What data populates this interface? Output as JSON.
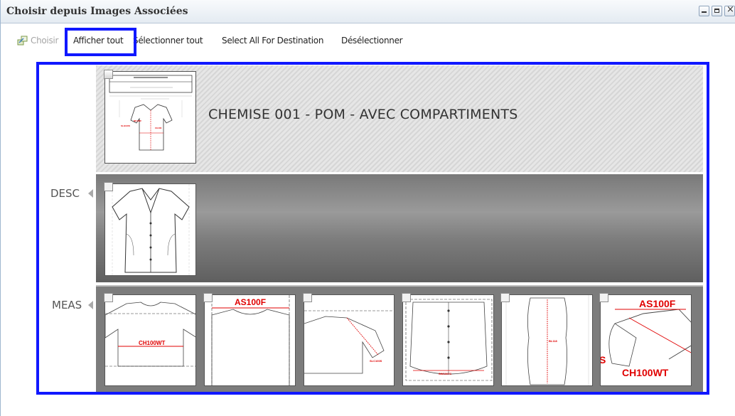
{
  "window": {
    "title": "Choisir depuis Images Associées"
  },
  "toolbar": {
    "choose": "Choisir",
    "show_all": "Afficher tout",
    "select_all": "Sélectionner tout",
    "select_all_dest": "Select All For Destination",
    "deselect": "Désélectionner"
  },
  "groups": {
    "document_title": "CHEMISE 001 - POM - AVEC COMPARTIMENTS",
    "desc_label": "DESC",
    "meas_label": "MEAS"
  },
  "thumbnails": {
    "meas_1_label": "CH100WT",
    "meas_2_label": "AS100F",
    "meas_3_label": "SLC100S",
    "meas_4_label": "SW100TC",
    "meas_5_label": "BL118",
    "meas_6_label_top": "AS100F",
    "meas_6_label_bottom": "CH100WT",
    "meas_6_label_side": "S"
  },
  "colors": {
    "highlight": "#1018ff",
    "measure_red": "#e00000"
  }
}
